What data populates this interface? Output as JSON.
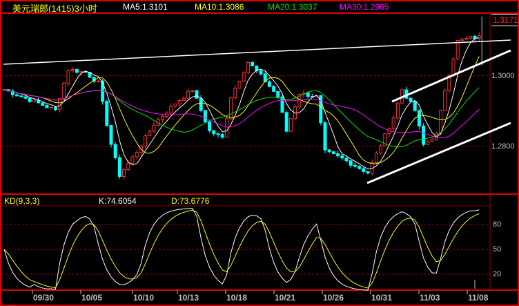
{
  "header": {
    "title": "美元瑞郎(1415)3小时",
    "ma5": "MA5:1.3101",
    "ma10": "MA10:1.3086",
    "ma20": "MA20:1.3037",
    "ma30": "MA30:1.2965",
    "last_price": "1.3171"
  },
  "indicator": {
    "name": "KD(9,3,3)",
    "k": "K:74.6054",
    "d": "D:73.6776"
  },
  "colors": {
    "up": "#ff3030",
    "down": "#00ffff",
    "ma5": "#ffffff",
    "ma10": "#ffff00",
    "ma20": "#00e000",
    "ma30": "#ff00ff",
    "grid": "#a00000"
  },
  "chart_data": [
    {
      "type": "candlestick",
      "title": "美元瑞郎(1415)3小时",
      "ylim": [
        1.2676,
        1.3176
      ],
      "y_ticks": [
        "1.3000",
        "1.2800"
      ],
      "x_ticks": [
        "09/30",
        "10/05",
        "10/10",
        "10/13",
        "10/18",
        "10/21",
        "10/26",
        "10/31",
        "11/03",
        "11/08"
      ],
      "close_anchors": [
        [
          0,
          1.2961
        ],
        [
          4,
          1.2941
        ],
        [
          8,
          1.2922
        ],
        [
          12,
          1.2902
        ],
        [
          15,
          1.3018
        ],
        [
          19,
          1.301
        ],
        [
          22,
          1.298
        ],
        [
          25,
          1.2806
        ],
        [
          27,
          1.2718
        ],
        [
          31,
          1.2785
        ],
        [
          35,
          1.2863
        ],
        [
          40,
          1.2922
        ],
        [
          44,
          1.2961
        ],
        [
          48,
          1.2843
        ],
        [
          51,
          1.2824
        ],
        [
          53,
          1.2941
        ],
        [
          57,
          1.3039
        ],
        [
          60,
          1.3
        ],
        [
          64,
          1.2941
        ],
        [
          66,
          1.2843
        ],
        [
          69,
          1.2951
        ],
        [
          73,
          1.2941
        ],
        [
          75,
          1.2784
        ],
        [
          79,
          1.2765
        ],
        [
          82,
          1.2745
        ],
        [
          85,
          1.2725
        ],
        [
          88,
          1.2804
        ],
        [
          91,
          1.2882
        ],
        [
          93,
          1.2961
        ],
        [
          96,
          1.2902
        ],
        [
          98,
          1.2804
        ],
        [
          101,
          1.2833
        ],
        [
          103,
          1.2961
        ],
        [
          106,
          1.3098
        ],
        [
          109,
          1.3108
        ],
        [
          111,
          1.311
        ]
      ],
      "overlay_lines": [
        "resistance",
        "channel-upper",
        "channel-lower"
      ],
      "series": [
        {
          "name": "MA5",
          "last": 1.3101
        },
        {
          "name": "MA10",
          "last": 1.3086
        },
        {
          "name": "MA20",
          "last": 1.3037
        },
        {
          "name": "MA30",
          "last": 1.2965
        }
      ]
    },
    {
      "type": "line",
      "title": "KD(9,3,3)",
      "ylim": [
        0,
        100
      ],
      "y_ticks": [
        "80",
        "50",
        "20"
      ],
      "series": [
        {
          "name": "K",
          "last": 74.6054
        },
        {
          "name": "D",
          "last": 73.6776
        }
      ]
    }
  ]
}
